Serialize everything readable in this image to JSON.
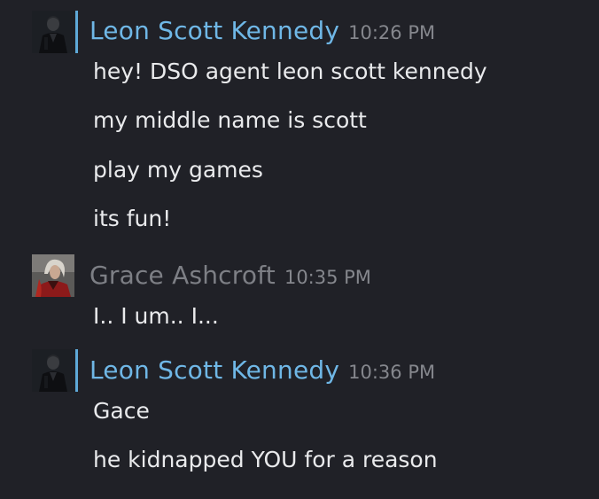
{
  "groups": [
    {
      "username": "Leon Scott Kennedy",
      "time": "10:26 PM",
      "status_color": "#5ea9d8",
      "name_color": "#6fb7e6",
      "avatar_icon": "leon-avatar",
      "messages": [
        "hey! DSO agent leon scott kennedy",
        "my middle name is scott",
        "play my games",
        "its fun!"
      ]
    },
    {
      "username": "Grace Ashcroft",
      "time": "10:35 PM",
      "name_color": "#7d7f85",
      "avatar_icon": "grace-avatar",
      "messages": [
        "I.. I um.. I..."
      ]
    },
    {
      "username": "Leon Scott Kennedy",
      "time": "10:36 PM",
      "status_color": "#5ea9d8",
      "name_color": "#6fb7e6",
      "avatar_icon": "leon-avatar",
      "messages": [
        "Gace",
        "he kidnapped YOU for a reason"
      ]
    }
  ],
  "colors": {
    "background": "#202127",
    "message_text": "#e9eaec",
    "timestamp": "#85878d"
  }
}
